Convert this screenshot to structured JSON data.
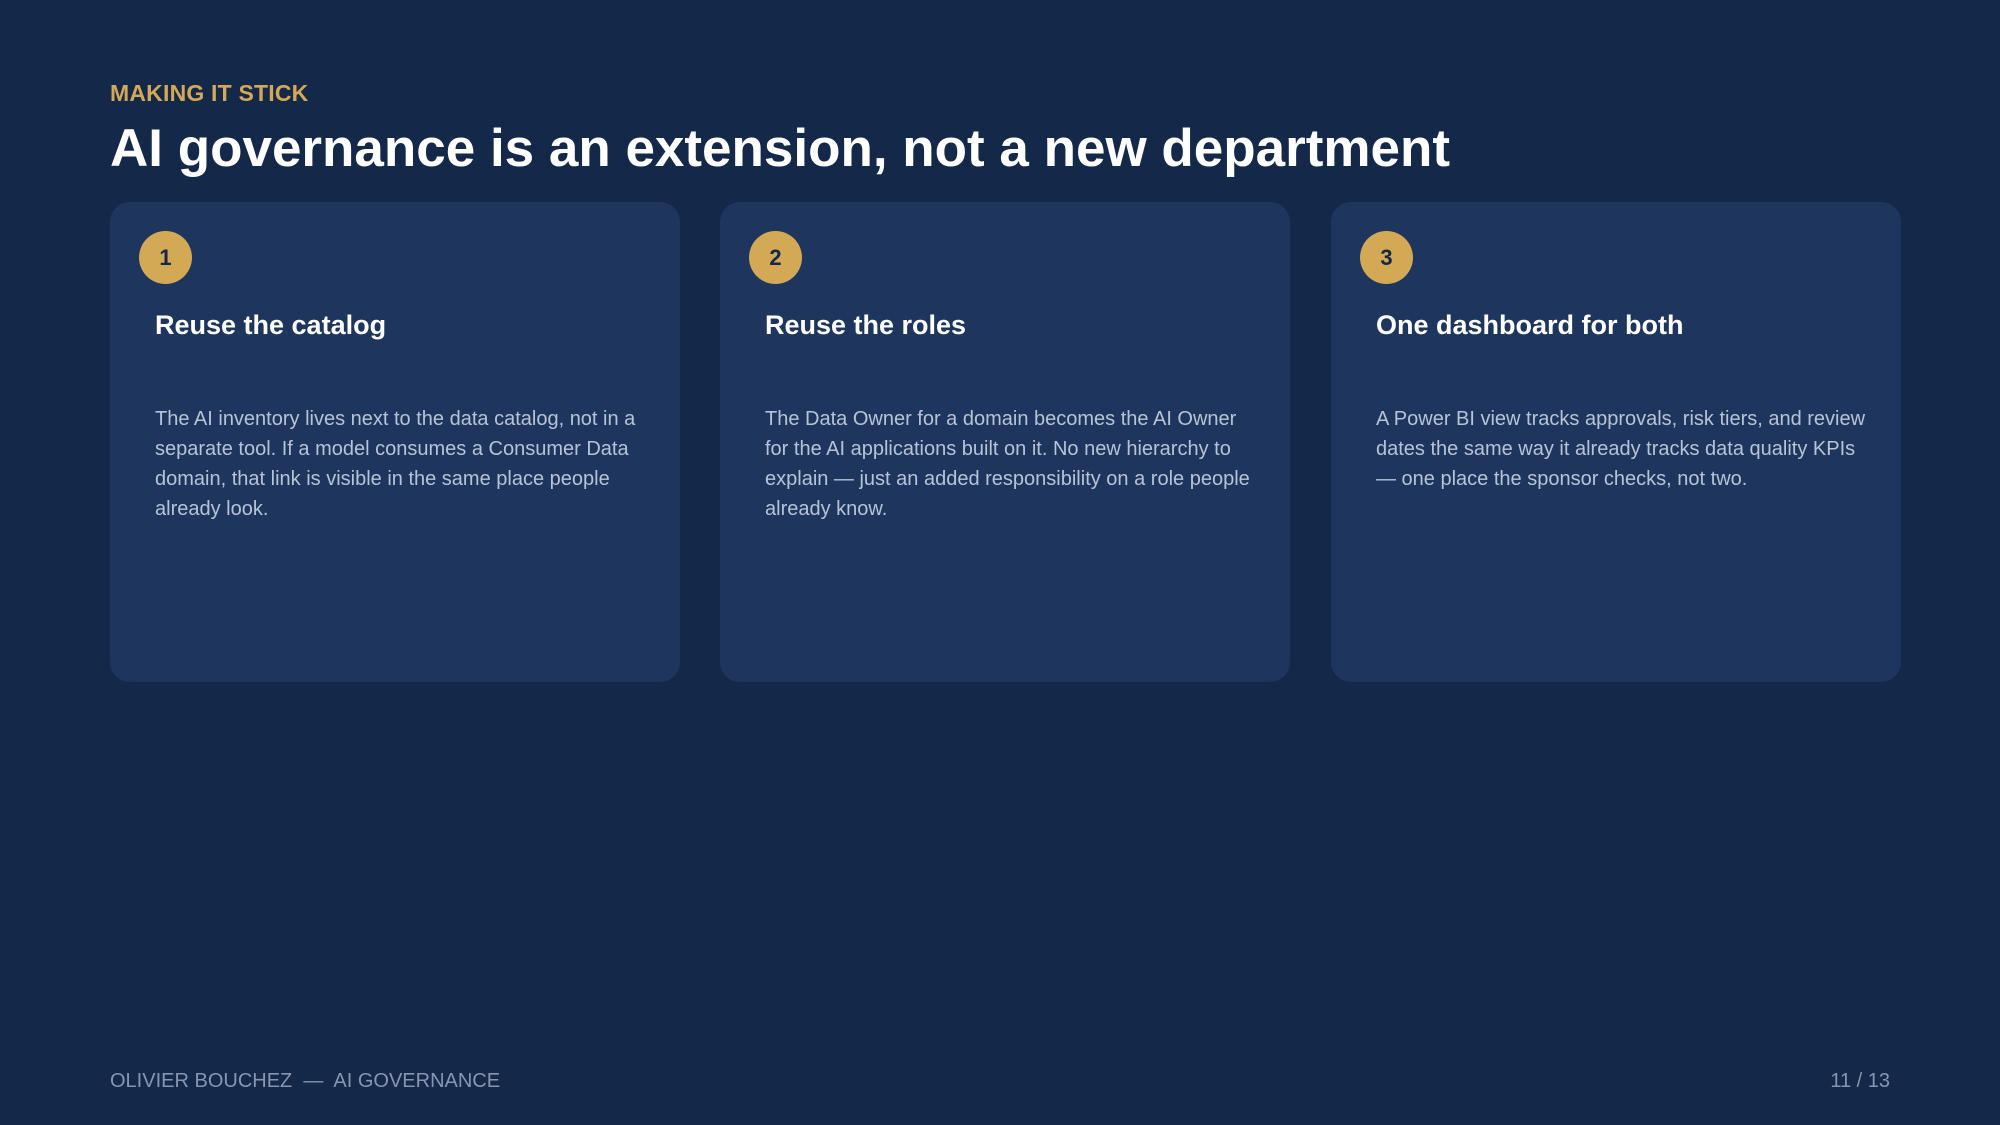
{
  "header": {
    "eyebrow": "MAKING IT STICK",
    "title": "AI governance is an extension, not a new department"
  },
  "cards": [
    {
      "number": "1",
      "title": "Reuse the catalog",
      "body": "The AI inventory lives next to the data catalog, not in a separate tool. If a model consumes a Consumer Data domain, that link is visible in the same place people already look."
    },
    {
      "number": "2",
      "title": "Reuse the roles",
      "body": "The Data Owner for a domain becomes the AI Owner for the AI applications built on it. No new hierarchy to explain — just an added responsibility on a role people already know."
    },
    {
      "number": "3",
      "title": "One dashboard for both",
      "body": "A Power BI view tracks approvals, risk tiers, and review dates the same way it already tracks data quality KPIs — one place the sponsor checks, not two."
    }
  ],
  "footer": {
    "left": "OLIVIER BOUCHEZ  —  AI GOVERNANCE",
    "page": "11 / 13"
  },
  "colors": {
    "background": "#14284a",
    "card": "#1e365e",
    "accent": "#d4a955"
  }
}
